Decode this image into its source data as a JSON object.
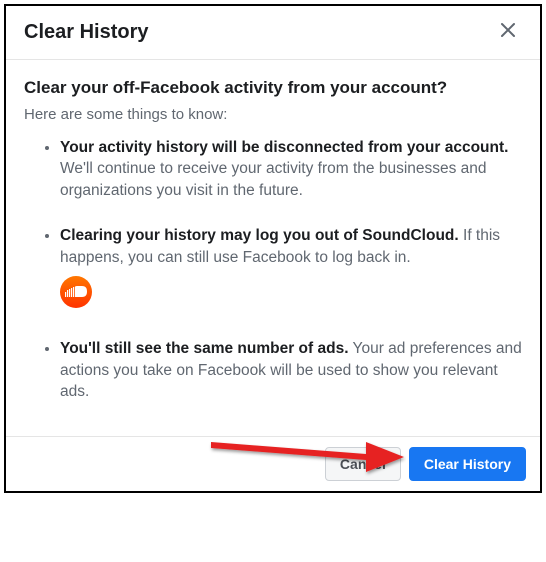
{
  "dialog": {
    "title": "Clear History",
    "heading": "Clear your off-Facebook activity from your account?",
    "subtext": "Here are some things to know:",
    "items": [
      {
        "bold": "Your activity history will be disconnected from your account.",
        "rest": " We'll continue to receive your activity from the businesses and organizations you visit in the future."
      },
      {
        "bold": "Clearing your history may log you out of SoundCloud.",
        "rest": " If this happens, you can still use Facebook to log back in."
      },
      {
        "bold": "You'll still see the same number of ads.",
        "rest": " Your ad preferences and actions you take on Facebook will be used to show you relevant ads."
      }
    ],
    "cancel_label": "Cancel",
    "confirm_label": "Clear History"
  }
}
